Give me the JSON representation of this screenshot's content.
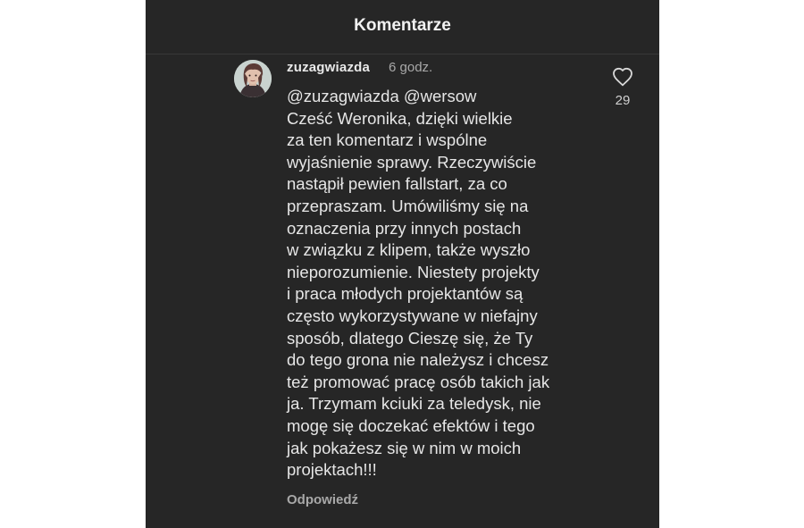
{
  "header": {
    "title": "Komentarze"
  },
  "comment": {
    "username": "zuzagwiazda",
    "time": "6 godz.",
    "lines": [
      "@zuzagwiazda @wersow",
      "Cześć Weronika, dzięki wielkie",
      "za ten komentarz i wspólne",
      "wyjaśnienie sprawy. Rzeczywiście",
      "nastąpił pewien fallstart, za co",
      "przepraszam. Umówiliśmy się na",
      "oznaczenia przy innych postach",
      "w związku z klipem, także wyszło",
      "nieporozumienie. Niestety projekty",
      "i praca młodych projektantów są",
      "często wykorzystywane w niefajny",
      "sposób, dlatego Cieszę się, że Ty",
      "do tego grona nie należysz i chcesz",
      "też promować pracę osób takich jak",
      "ja. Trzymam kciuki za teledysk, nie",
      "mogę się doczekać efektów i tego",
      "jak pokażesz się w nim w moich",
      "projektach!!!"
    ],
    "reply_label": "Odpowiedź",
    "like_icon": "heart-outline-icon",
    "like_count": "29"
  },
  "colors": {
    "background": "#262626",
    "text_primary": "#e6e6e6",
    "text_secondary": "#a8a8a8"
  }
}
